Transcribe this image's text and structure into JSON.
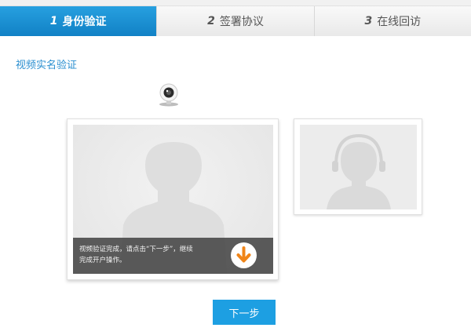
{
  "steps": [
    {
      "num": "1",
      "label": "身份验证"
    },
    {
      "num": "2",
      "label": "签署协议"
    },
    {
      "num": "3",
      "label": "在线回访"
    }
  ],
  "section": {
    "title": "视频实名验证"
  },
  "video": {
    "status_line1": "视频验证完成，请点击“下一步”，继续",
    "status_line2": "完成开户操作。"
  },
  "actions": {
    "next_label": "下一步"
  },
  "colors": {
    "accent": "#1d9fe2",
    "download": "#f08519",
    "active_step": "#1a8ed3"
  },
  "icons": {
    "webcam": "webcam-icon",
    "download": "arrow-down-icon",
    "user_silhouette": "user-silhouette-icon",
    "agent_silhouette": "agent-headset-icon"
  }
}
